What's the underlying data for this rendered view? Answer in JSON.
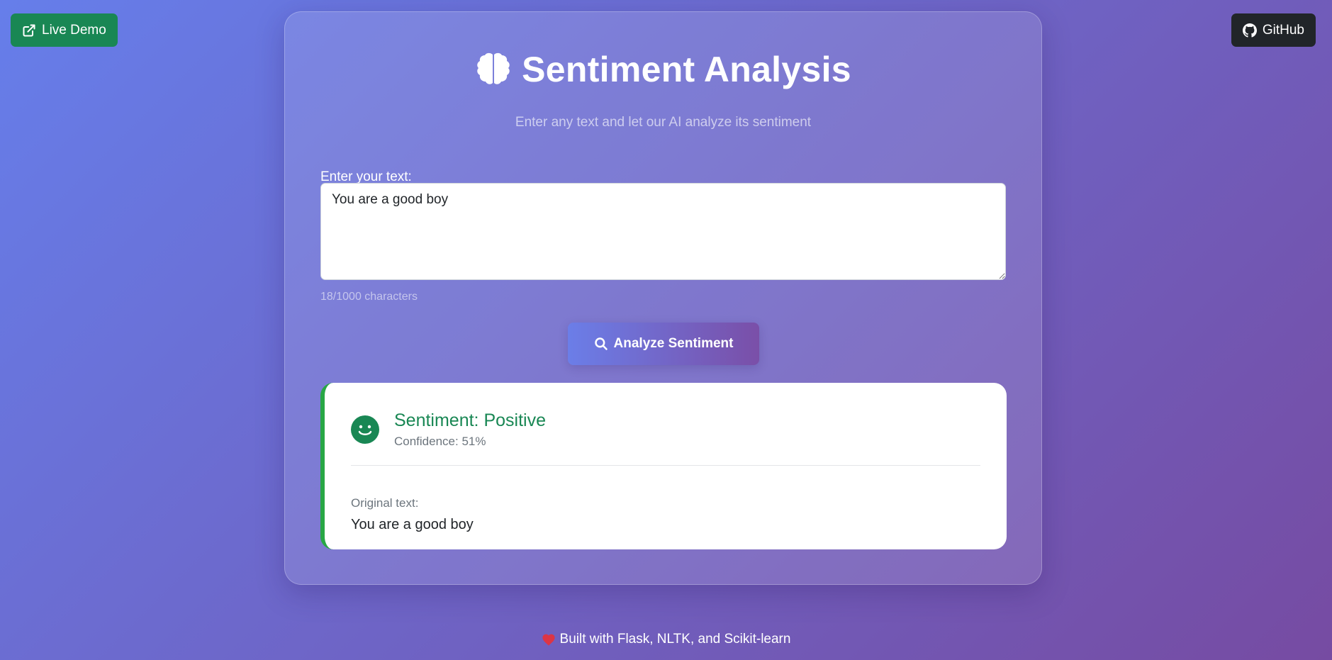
{
  "top_nav": {
    "live_demo_label": "Live Demo",
    "live_demo_icon": "external-link-icon",
    "github_label": "GitHub",
    "github_icon": "github-icon"
  },
  "header": {
    "title": "Sentiment Analysis",
    "title_icon": "brain-icon",
    "subtitle": "Enter any text and let our AI analyze its sentiment"
  },
  "input": {
    "label": "Enter your text:",
    "value": "You are a good boy",
    "char_count": "18/1000 characters"
  },
  "analyze_button": {
    "label": "Analyze Sentiment",
    "icon": "search-icon"
  },
  "result": {
    "icon": "smiley-icon",
    "title": "Sentiment: Positive",
    "confidence": "Confidence: 51%",
    "original_label": "Original text:",
    "original_text": "You are a good boy",
    "accent_color": "#28a745",
    "title_color": "#198754"
  },
  "footer": {
    "icon": "heart-icon",
    "text": "Built with Flask, NLTK, and Scikit-learn"
  },
  "colors": {
    "background_start": "#667eea",
    "background_end": "#764ba2",
    "live_demo_bg": "#198754",
    "github_bg": "#212529",
    "heart": "#dc3545"
  }
}
